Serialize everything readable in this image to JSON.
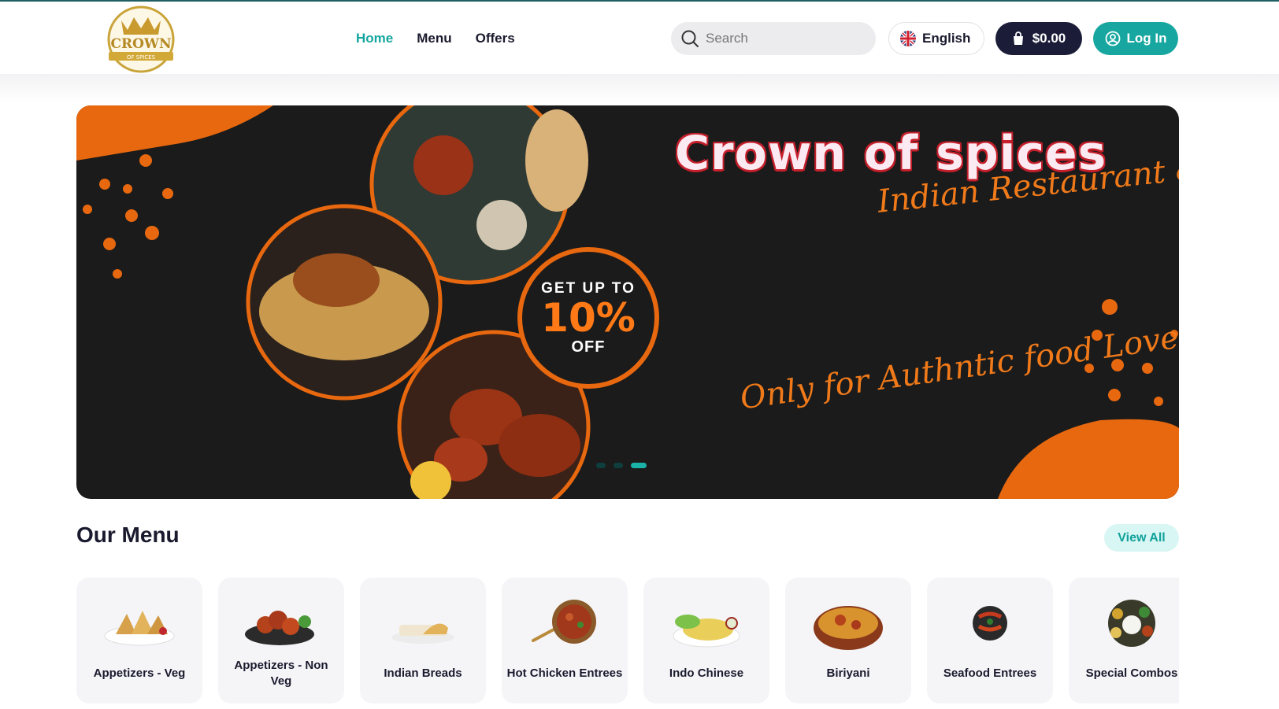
{
  "brand": {
    "logo_text": "CROWN",
    "logo_sub": "OF SPICES"
  },
  "nav": {
    "items": [
      {
        "label": "Home",
        "active": true
      },
      {
        "label": "Menu",
        "active": false
      },
      {
        "label": "Offers",
        "active": false
      }
    ]
  },
  "search": {
    "placeholder": "Search",
    "value": ""
  },
  "language": {
    "label": "English",
    "icon": "uk-flag-icon"
  },
  "cart": {
    "label": "$0.00",
    "icon": "shopping-bag-icon"
  },
  "login": {
    "label": "Log In",
    "icon": "user-circle-icon"
  },
  "banner": {
    "title": "Crown of spices",
    "subtitle": "Indian Restaurant & Bar",
    "tagline": "Only for Authntic food Lovers",
    "offer_line1": "GET UP TO",
    "offer_value": "10%",
    "offer_line3": "OFF",
    "slides": 3,
    "active_slide": 3
  },
  "menu": {
    "title": "Our Menu",
    "view_all": "View All",
    "categories": [
      {
        "label": "Appetizers - Veg",
        "icon": "samosa-icon"
      },
      {
        "label": "Appetizers - Non Veg",
        "icon": "chicken-wings-icon"
      },
      {
        "label": "Indian Breads",
        "icon": "bread-icon"
      },
      {
        "label": "Hot Chicken Entrees",
        "icon": "curry-pan-icon"
      },
      {
        "label": "Indo Chinese",
        "icon": "fried-rice-icon"
      },
      {
        "label": "Biriyani",
        "icon": "biriyani-bowl-icon"
      },
      {
        "label": "Seafood Entrees",
        "icon": "seafood-plate-icon"
      },
      {
        "label": "Special Combos",
        "icon": "thali-icon"
      }
    ]
  },
  "colors": {
    "accent": "#17a7a0",
    "dark": "#1b1d38",
    "banner_bg": "#1b1b1b",
    "orange": "#e8680f"
  }
}
